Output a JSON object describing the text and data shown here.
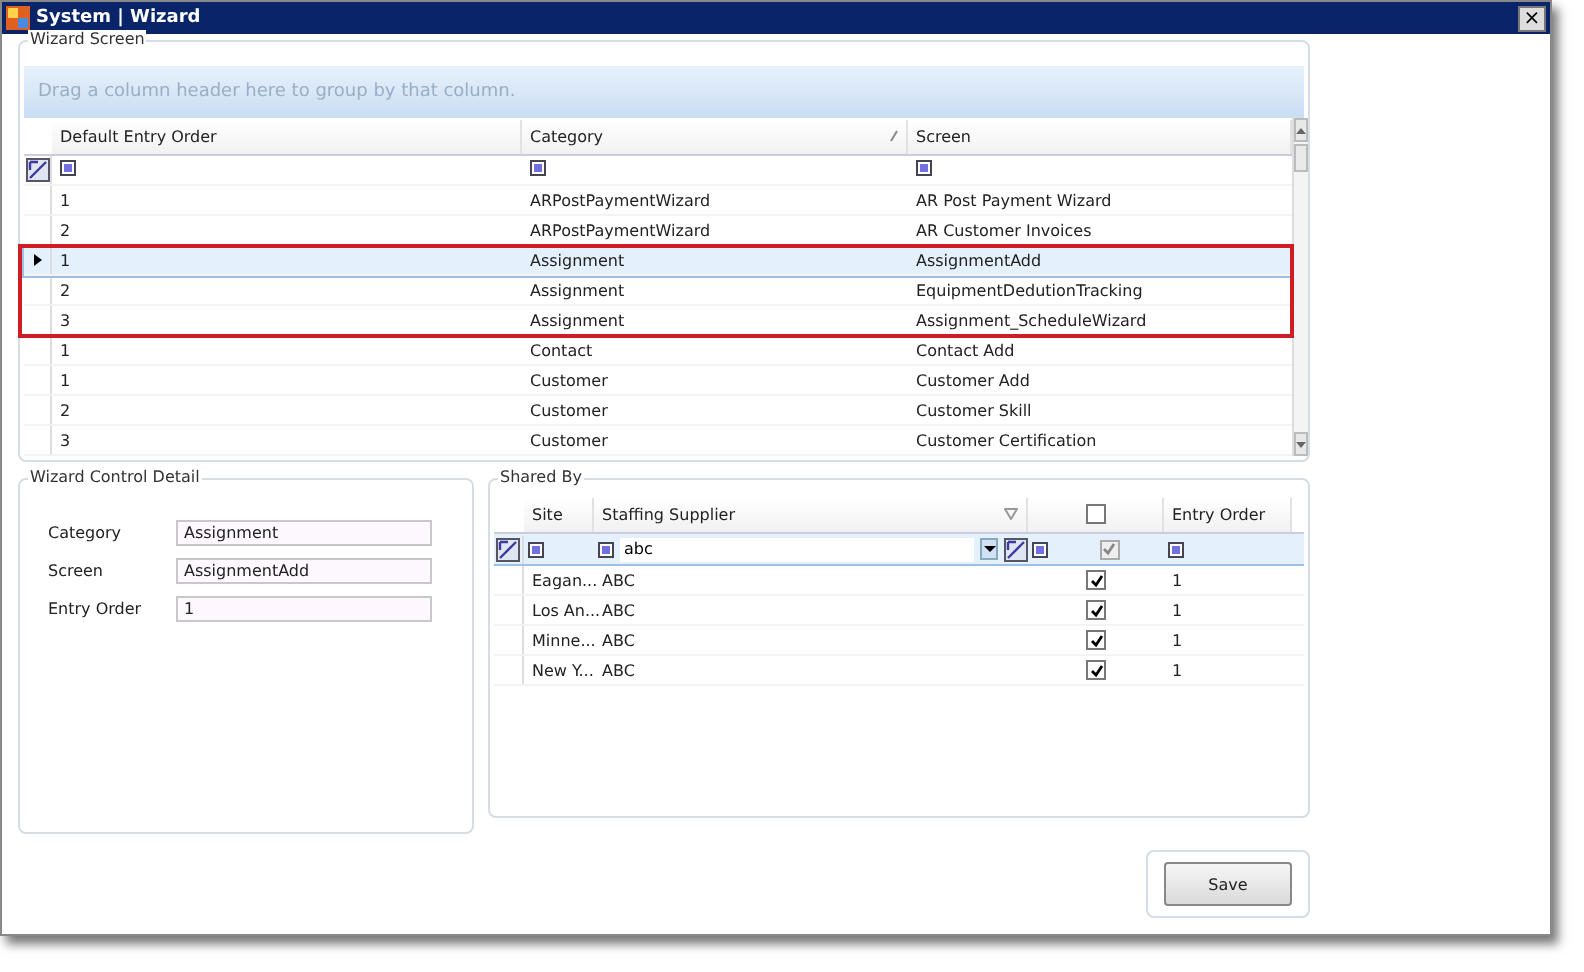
{
  "window": {
    "title": "System | Wizard",
    "close": "×"
  },
  "wizard_screen": {
    "title": "Wizard Screen",
    "group_hint": "Drag a column header here to group by that column.",
    "columns": [
      {
        "label": "Default Entry Order",
        "sorted": false
      },
      {
        "label": "Category",
        "sorted": true
      },
      {
        "label": "Screen",
        "sorted": false
      }
    ],
    "rows": [
      {
        "entry_order": "1",
        "category": "ARPostPaymentWizard",
        "screen": "AR Post Payment Wizard",
        "selected": false,
        "highlighted": false
      },
      {
        "entry_order": "2",
        "category": "ARPostPaymentWizard",
        "screen": "AR Customer Invoices",
        "selected": false,
        "highlighted": false
      },
      {
        "entry_order": "1",
        "category": "Assignment",
        "screen": "AssignmentAdd",
        "selected": true,
        "highlighted": true
      },
      {
        "entry_order": "2",
        "category": "Assignment",
        "screen": "EquipmentDedutionTracking",
        "selected": false,
        "highlighted": true
      },
      {
        "entry_order": "3",
        "category": "Assignment",
        "screen": "Assignment_ScheduleWizard",
        "selected": false,
        "highlighted": true
      },
      {
        "entry_order": "1",
        "category": "Contact",
        "screen": "Contact Add",
        "selected": false,
        "highlighted": false
      },
      {
        "entry_order": "1",
        "category": "Customer",
        "screen": "Customer Add",
        "selected": false,
        "highlighted": false
      },
      {
        "entry_order": "2",
        "category": "Customer",
        "screen": "Customer Skill",
        "selected": false,
        "highlighted": false
      },
      {
        "entry_order": "3",
        "category": "Customer",
        "screen": "Customer Certification",
        "selected": false,
        "highlighted": false
      }
    ]
  },
  "detail": {
    "title": "Wizard Control Detail",
    "fields": [
      {
        "label": "Category",
        "value": "Assignment"
      },
      {
        "label": "Screen",
        "value": "AssignmentAdd"
      },
      {
        "label": "Entry Order",
        "value": "1"
      }
    ]
  },
  "shared_by": {
    "title": "Shared By",
    "columns": [
      {
        "label": "Site"
      },
      {
        "label": "Staffing Supplier"
      },
      {
        "label": "Entry Order"
      }
    ],
    "header_checked": false,
    "filter": {
      "supplier": "abc",
      "checked": true
    },
    "rows": [
      {
        "site": "Eagan...",
        "supplier": "ABC",
        "checked": true,
        "entry_order": "1"
      },
      {
        "site": "Los An...",
        "supplier": "ABC",
        "checked": true,
        "entry_order": "1"
      },
      {
        "site": "Minne...",
        "supplier": "ABC",
        "checked": true,
        "entry_order": "1"
      },
      {
        "site": "New Y...",
        "supplier": "ABC",
        "checked": true,
        "entry_order": "1"
      }
    ]
  },
  "save": "Save"
}
